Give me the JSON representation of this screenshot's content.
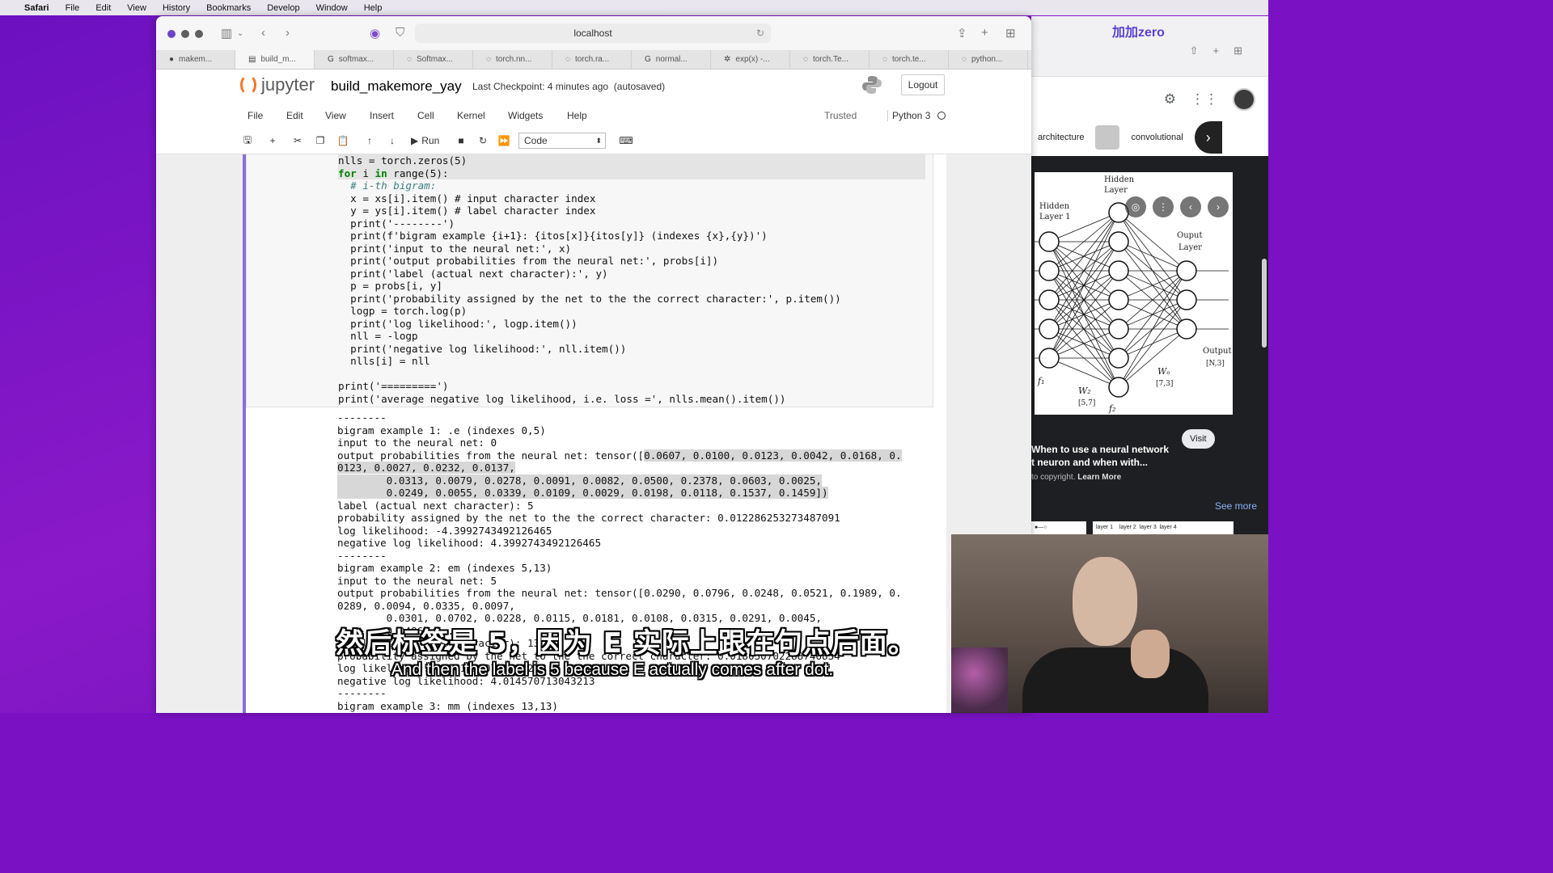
{
  "macos_menu": {
    "apple": "",
    "items": [
      "Safari",
      "File",
      "Edit",
      "View",
      "History",
      "Bookmarks",
      "Develop",
      "Window",
      "Help"
    ]
  },
  "safari": {
    "url": "localhost",
    "tabs": [
      "makem...",
      "build_m...",
      "softmax...",
      "Softmax...",
      "torch.nn...",
      "torch.ra...",
      "normal...",
      "exp(x) -...",
      "torch.Te...",
      "torch.te...",
      "python..."
    ]
  },
  "jupyter": {
    "logo_text": "jupyter",
    "notebook_name": "build_makemore_yay",
    "checkpoint": "Last Checkpoint: 4 minutes ago",
    "autosave": "(autosaved)",
    "logout": "Logout",
    "menu": [
      "File",
      "Edit",
      "View",
      "Insert",
      "Cell",
      "Kernel",
      "Widgets",
      "Help"
    ],
    "trusted": "Trusted",
    "kernel": "Python 3",
    "run_label": "Run",
    "cell_type": "Code"
  },
  "code_lines": [
    "nlls = torch.zeros(5)",
    "for i in range(5):",
    "  # i-th bigram:",
    "  x = xs[i].item() # input character index",
    "  y = ys[i].item() # label character index",
    "  print('--------')",
    "  print(f'bigram example {i+1}: {itos[x]}{itos[y]} (indexes {x},{y})')",
    "  print('input to the neural net:', x)",
    "  print('output probabilities from the neural net:', probs[i])",
    "  print('label (actual next character):', y)",
    "  p = probs[i, y]",
    "  print('probability assigned by the net to the the correct character:', p.item())",
    "  logp = torch.log(p)",
    "  print('log likelihood:', logp.item())",
    "  nll = -logp",
    "  print('negative log likelihood:', nll.item())",
    "  nlls[i] = nll",
    "",
    "print('=========')",
    "print('average negative log likelihood, i.e. loss =', nlls.mean().item())"
  ],
  "output_lines": [
    "--------",
    "bigram example 1: .e (indexes 0,5)",
    "input to the neural net: 0",
    "output probabilities from the neural net: tensor([0.0607, 0.0100, 0.0123, 0.0042, 0.0168, 0.",
    "0123, 0.0027, 0.0232, 0.0137,",
    "        0.0313, 0.0079, 0.0278, 0.0091, 0.0082, 0.0500, 0.2378, 0.0603, 0.0025,",
    "        0.0249, 0.0055, 0.0339, 0.0109, 0.0029, 0.0198, 0.0118, 0.1537, 0.1459])",
    "label (actual next character): 5",
    "probability assigned by the net to the the correct character: 0.012286253273487091",
    "log likelihood: -4.3992743492126465",
    "negative log likelihood: 4.3992743492126465",
    "--------",
    "bigram example 2: em (indexes 5,13)",
    "input to the neural net: 5",
    "output probabilities from the neural net: tensor([0.0290, 0.0796, 0.0248, 0.0521, 0.1989, 0.",
    "0289, 0.0094, 0.0335, 0.0097,",
    "        0.0301, 0.0702, 0.0228, 0.0115, 0.0181, 0.0108, 0.0315, 0.0291, 0.0045,",
    "        0.0486, ...",
    "label (actual next character): 13",
    "probability assigned by the net to the the correct character: 0.018050702288746834",
    "log likelihood: -4.014570713043213",
    "negative log likelihood: 4.014570713043213",
    "--------",
    "bigram example 3: mm (indexes 13,13)"
  ],
  "google_panel": {
    "brand": "加加zero",
    "chips": [
      "architecture",
      "convolutional"
    ],
    "image_labels": {
      "hidden1": "Hidden\nLayer 1",
      "hidden2": "Hidden\nLayer",
      "output_layer": "Ouput\nLayer",
      "output": "Output\n[N,3]",
      "w2": "W₂\n[5,7]",
      "wo": "Wₒ\n[7,3]",
      "f1": "f₁",
      "f2": "f₂"
    },
    "title": "When to use a neural network\nt neuron and when with...",
    "visit": "Visit",
    "copyright": "to copyright.",
    "learn_more": "Learn More",
    "see_more": "See more",
    "thumb2_labels": [
      "layer 1",
      "layer 2",
      "layer 3",
      "layer 4"
    ]
  },
  "subtitles": {
    "chinese": "然后标签是 5，因为 E 实际上跟在句点后面。",
    "english": "And then the label is 5 because E actually comes after dot."
  }
}
